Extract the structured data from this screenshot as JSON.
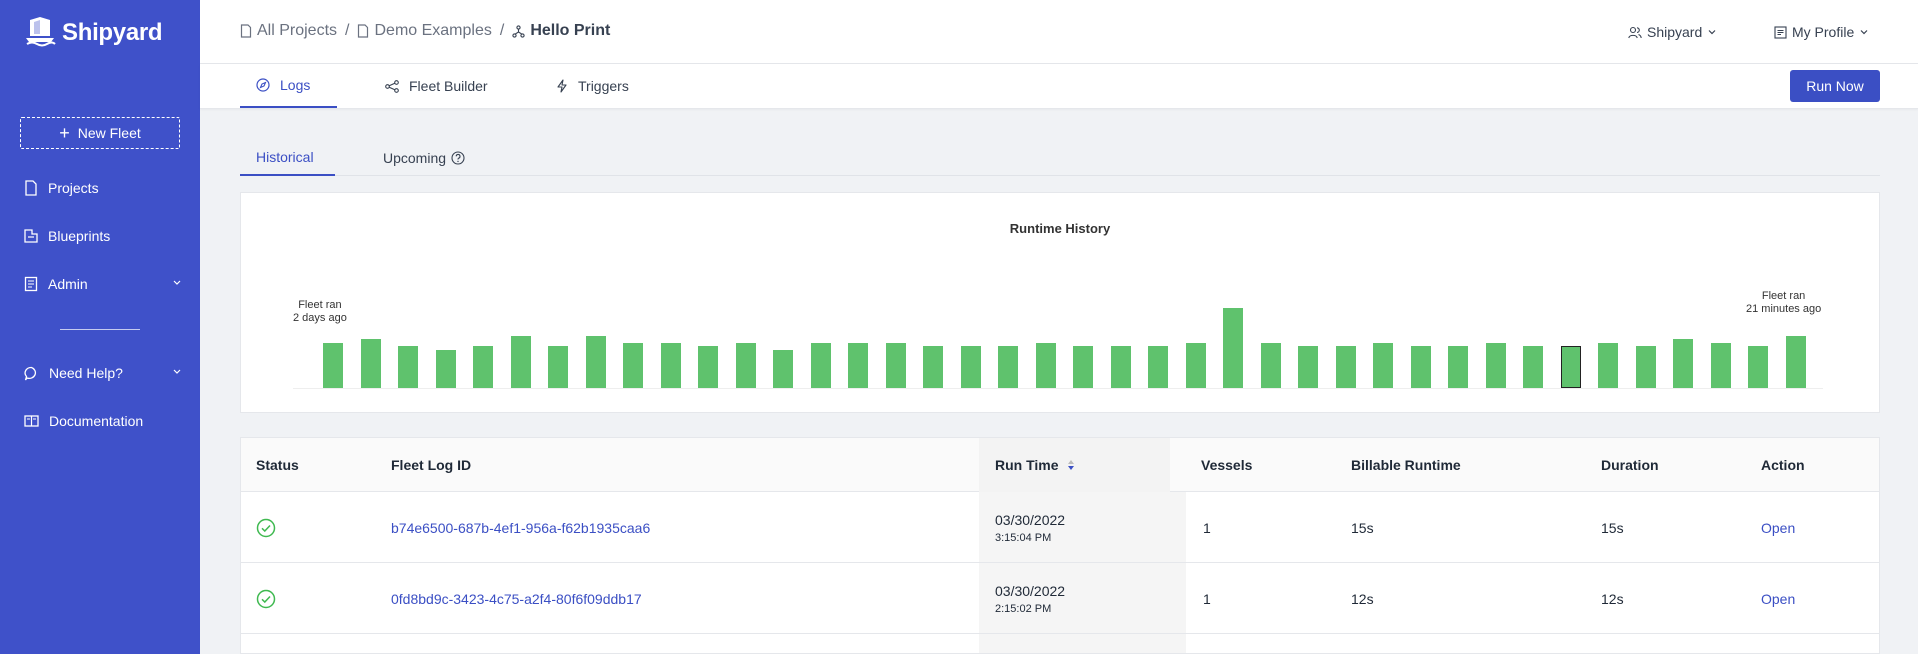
{
  "brand": {
    "name": "Shipyard"
  },
  "sidebar": {
    "new_fleet": "New Fleet",
    "items": [
      {
        "label": "Projects",
        "icon": "document-icon"
      },
      {
        "label": "Blueprints",
        "icon": "blueprint-icon"
      },
      {
        "label": "Admin",
        "icon": "admin-icon",
        "expandable": true
      },
      {
        "label": "Need Help?",
        "icon": "chat-icon",
        "expandable": true
      },
      {
        "label": "Documentation",
        "icon": "book-icon"
      }
    ]
  },
  "breadcrumb": {
    "items": [
      {
        "label": "All Projects",
        "icon": "document-icon"
      },
      {
        "label": "Demo Examples",
        "icon": "document-icon"
      },
      {
        "label": "Hello Print",
        "icon": "fleet-icon"
      }
    ],
    "separator": "/"
  },
  "header": {
    "org_menu": "Shipyard",
    "profile_menu": "My Profile"
  },
  "tabs": [
    {
      "label": "Logs",
      "icon": "compass-icon",
      "active": true
    },
    {
      "label": "Fleet Builder",
      "icon": "nodes-icon",
      "active": false
    },
    {
      "label": "Triggers",
      "icon": "lightning-icon",
      "active": false
    }
  ],
  "run_now": "Run Now",
  "subtabs": [
    {
      "label": "Historical",
      "active": true
    },
    {
      "label": "Upcoming",
      "active": false,
      "icon": "help-circle-icon"
    }
  ],
  "chart_data": {
    "type": "bar",
    "title": "Runtime History",
    "xlabel": "",
    "ylabel": "",
    "annotations": {
      "left_line1": "Fleet ran",
      "left_line2": "2 days ago",
      "right_line1": "Fleet ran",
      "right_line2": "21 minutes ago"
    },
    "values": [
      13,
      14,
      12,
      11,
      12,
      15,
      12,
      15,
      13,
      13,
      12,
      13,
      11,
      13,
      13,
      13,
      12,
      12,
      12,
      13,
      12,
      12,
      12,
      13,
      23,
      13,
      12,
      12,
      13,
      12,
      12,
      13,
      12,
      12,
      13,
      12,
      14,
      13,
      12,
      15
    ],
    "selected_index": 33,
    "color": "#5fc26d",
    "ylim": [
      0,
      30
    ]
  },
  "table": {
    "columns": [
      "Status",
      "Fleet Log ID",
      "Run Time",
      "Vessels",
      "Billable Runtime",
      "Duration",
      "Action"
    ],
    "sorted_column": "Run Time",
    "rows": [
      {
        "status": "success",
        "id": "b74e6500-687b-4ef1-956a-f62b1935caa6",
        "date": "03/30/2022",
        "time": "3:15:04 PM",
        "vessels": "1",
        "billable": "15s",
        "duration": "15s",
        "action": "Open"
      },
      {
        "status": "success",
        "id": "0fd8bd9c-3423-4c75-a2f4-80f6f09ddb17",
        "date": "03/30/2022",
        "time": "2:15:02 PM",
        "vessels": "1",
        "billable": "12s",
        "duration": "12s",
        "action": "Open"
      }
    ]
  },
  "colors": {
    "sidebar": "#3f51c9",
    "accent": "#3b4fc4",
    "success": "#3fb950"
  }
}
